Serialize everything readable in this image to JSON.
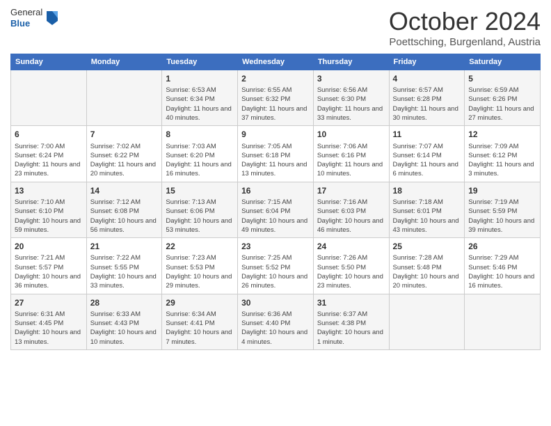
{
  "header": {
    "logo_line1": "General",
    "logo_line2": "Blue",
    "month": "October 2024",
    "location": "Poettsching, Burgenland, Austria"
  },
  "weekdays": [
    "Sunday",
    "Monday",
    "Tuesday",
    "Wednesday",
    "Thursday",
    "Friday",
    "Saturday"
  ],
  "weeks": [
    [
      {
        "day": "",
        "info": ""
      },
      {
        "day": "",
        "info": ""
      },
      {
        "day": "1",
        "info": "Sunrise: 6:53 AM\nSunset: 6:34 PM\nDaylight: 11 hours and 40 minutes."
      },
      {
        "day": "2",
        "info": "Sunrise: 6:55 AM\nSunset: 6:32 PM\nDaylight: 11 hours and 37 minutes."
      },
      {
        "day": "3",
        "info": "Sunrise: 6:56 AM\nSunset: 6:30 PM\nDaylight: 11 hours and 33 minutes."
      },
      {
        "day": "4",
        "info": "Sunrise: 6:57 AM\nSunset: 6:28 PM\nDaylight: 11 hours and 30 minutes."
      },
      {
        "day": "5",
        "info": "Sunrise: 6:59 AM\nSunset: 6:26 PM\nDaylight: 11 hours and 27 minutes."
      }
    ],
    [
      {
        "day": "6",
        "info": "Sunrise: 7:00 AM\nSunset: 6:24 PM\nDaylight: 11 hours and 23 minutes."
      },
      {
        "day": "7",
        "info": "Sunrise: 7:02 AM\nSunset: 6:22 PM\nDaylight: 11 hours and 20 minutes."
      },
      {
        "day": "8",
        "info": "Sunrise: 7:03 AM\nSunset: 6:20 PM\nDaylight: 11 hours and 16 minutes."
      },
      {
        "day": "9",
        "info": "Sunrise: 7:05 AM\nSunset: 6:18 PM\nDaylight: 11 hours and 13 minutes."
      },
      {
        "day": "10",
        "info": "Sunrise: 7:06 AM\nSunset: 6:16 PM\nDaylight: 11 hours and 10 minutes."
      },
      {
        "day": "11",
        "info": "Sunrise: 7:07 AM\nSunset: 6:14 PM\nDaylight: 11 hours and 6 minutes."
      },
      {
        "day": "12",
        "info": "Sunrise: 7:09 AM\nSunset: 6:12 PM\nDaylight: 11 hours and 3 minutes."
      }
    ],
    [
      {
        "day": "13",
        "info": "Sunrise: 7:10 AM\nSunset: 6:10 PM\nDaylight: 10 hours and 59 minutes."
      },
      {
        "day": "14",
        "info": "Sunrise: 7:12 AM\nSunset: 6:08 PM\nDaylight: 10 hours and 56 minutes."
      },
      {
        "day": "15",
        "info": "Sunrise: 7:13 AM\nSunset: 6:06 PM\nDaylight: 10 hours and 53 minutes."
      },
      {
        "day": "16",
        "info": "Sunrise: 7:15 AM\nSunset: 6:04 PM\nDaylight: 10 hours and 49 minutes."
      },
      {
        "day": "17",
        "info": "Sunrise: 7:16 AM\nSunset: 6:03 PM\nDaylight: 10 hours and 46 minutes."
      },
      {
        "day": "18",
        "info": "Sunrise: 7:18 AM\nSunset: 6:01 PM\nDaylight: 10 hours and 43 minutes."
      },
      {
        "day": "19",
        "info": "Sunrise: 7:19 AM\nSunset: 5:59 PM\nDaylight: 10 hours and 39 minutes."
      }
    ],
    [
      {
        "day": "20",
        "info": "Sunrise: 7:21 AM\nSunset: 5:57 PM\nDaylight: 10 hours and 36 minutes."
      },
      {
        "day": "21",
        "info": "Sunrise: 7:22 AM\nSunset: 5:55 PM\nDaylight: 10 hours and 33 minutes."
      },
      {
        "day": "22",
        "info": "Sunrise: 7:23 AM\nSunset: 5:53 PM\nDaylight: 10 hours and 29 minutes."
      },
      {
        "day": "23",
        "info": "Sunrise: 7:25 AM\nSunset: 5:52 PM\nDaylight: 10 hours and 26 minutes."
      },
      {
        "day": "24",
        "info": "Sunrise: 7:26 AM\nSunset: 5:50 PM\nDaylight: 10 hours and 23 minutes."
      },
      {
        "day": "25",
        "info": "Sunrise: 7:28 AM\nSunset: 5:48 PM\nDaylight: 10 hours and 20 minutes."
      },
      {
        "day": "26",
        "info": "Sunrise: 7:29 AM\nSunset: 5:46 PM\nDaylight: 10 hours and 16 minutes."
      }
    ],
    [
      {
        "day": "27",
        "info": "Sunrise: 6:31 AM\nSunset: 4:45 PM\nDaylight: 10 hours and 13 minutes."
      },
      {
        "day": "28",
        "info": "Sunrise: 6:33 AM\nSunset: 4:43 PM\nDaylight: 10 hours and 10 minutes."
      },
      {
        "day": "29",
        "info": "Sunrise: 6:34 AM\nSunset: 4:41 PM\nDaylight: 10 hours and 7 minutes."
      },
      {
        "day": "30",
        "info": "Sunrise: 6:36 AM\nSunset: 4:40 PM\nDaylight: 10 hours and 4 minutes."
      },
      {
        "day": "31",
        "info": "Sunrise: 6:37 AM\nSunset: 4:38 PM\nDaylight: 10 hours and 1 minute."
      },
      {
        "day": "",
        "info": ""
      },
      {
        "day": "",
        "info": ""
      }
    ]
  ]
}
